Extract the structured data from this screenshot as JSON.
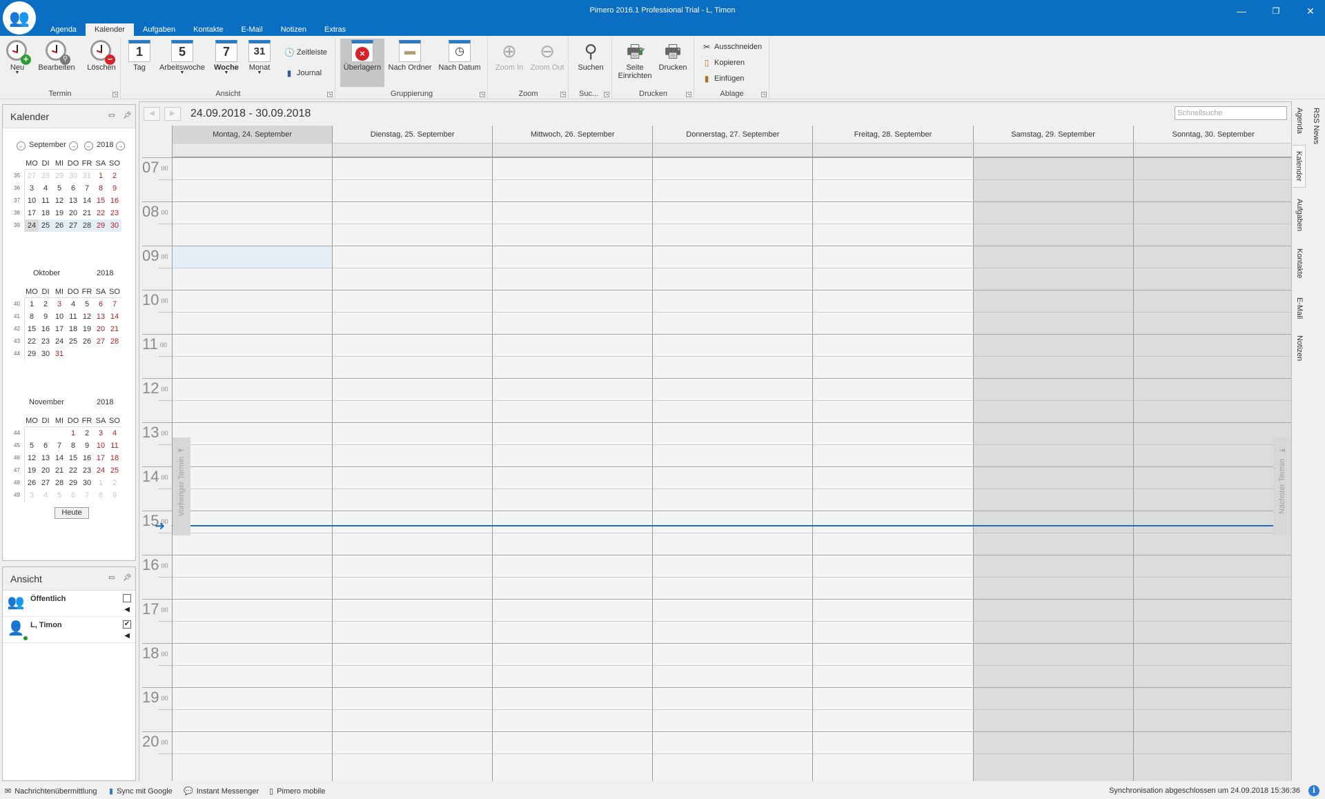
{
  "window": {
    "title": "Pimero 2016.1 Professional Trial  - L, Timon",
    "controls": [
      "minimize",
      "restore",
      "close"
    ]
  },
  "menu_tabs": [
    {
      "label": "Agenda",
      "active": false
    },
    {
      "label": "Kalender",
      "active": true
    },
    {
      "label": "Aufgaben",
      "active": false
    },
    {
      "label": "Kontakte",
      "active": false
    },
    {
      "label": "E-Mail",
      "active": false
    },
    {
      "label": "Notizen",
      "active": false
    },
    {
      "label": "Extras",
      "active": false
    }
  ],
  "ribbon": {
    "groups": {
      "termin": "Termin",
      "ansicht": "Ansicht",
      "gruppierung": "Gruppierung",
      "zoom": "Zoom",
      "suchen": "Suc...",
      "drucken": "Drucken",
      "ablage": "Ablage"
    },
    "buttons": {
      "neu": "Neu",
      "bearbeiten": "Bearbeiten",
      "loeschen": "Löschen",
      "tag": "Tag",
      "tag_num": "1",
      "arbeitswoche": "Arbeitswoche",
      "arbeitswoche_num": "5",
      "woche": "Woche",
      "woche_num": "7",
      "monat": "Monat",
      "monat_num": "31",
      "zeitleiste": "Zeitleiste",
      "journal": "Journal",
      "ueberlagern": "Überlagern",
      "nach_ordner": "Nach Ordner",
      "nach_datum": "Nach Datum",
      "zoom_in": "Zoom In",
      "zoom_out": "Zoom Out",
      "suchen": "Suchen",
      "seite_einrichten_1": "Seite",
      "seite_einrichten_2": "Einrichten",
      "drucken": "Drucken",
      "ausschneiden": "Ausschneiden",
      "kopieren": "Kopieren",
      "einfuegen": "Einfügen"
    }
  },
  "kalender_panel": {
    "title": "Kalender",
    "months": [
      {
        "month": "September",
        "year": "2018",
        "show_nav": true,
        "dow": [
          "MO",
          "DI",
          "MI",
          "DO",
          "FR",
          "SA",
          "SO"
        ],
        "weeks": [
          {
            "wk": "35",
            "days": [
              [
                "27",
                "other"
              ],
              [
                "28",
                "other"
              ],
              [
                "29",
                "other"
              ],
              [
                "30",
                "other"
              ],
              [
                "31",
                "other"
              ],
              [
                "1",
                "we"
              ],
              [
                "2",
                "we"
              ]
            ]
          },
          {
            "wk": "36",
            "days": [
              [
                "3",
                ""
              ],
              [
                "4",
                ""
              ],
              [
                "5",
                ""
              ],
              [
                "6",
                ""
              ],
              [
                "7",
                ""
              ],
              [
                "8",
                "we"
              ],
              [
                "9",
                "we"
              ]
            ]
          },
          {
            "wk": "37",
            "days": [
              [
                "10",
                ""
              ],
              [
                "11",
                ""
              ],
              [
                "12",
                ""
              ],
              [
                "13",
                ""
              ],
              [
                "14",
                ""
              ],
              [
                "15",
                "we"
              ],
              [
                "16",
                "we"
              ]
            ]
          },
          {
            "wk": "38",
            "days": [
              [
                "17",
                ""
              ],
              [
                "18",
                ""
              ],
              [
                "19",
                ""
              ],
              [
                "20",
                ""
              ],
              [
                "21",
                ""
              ],
              [
                "22",
                "we"
              ],
              [
                "23",
                "we"
              ]
            ]
          },
          {
            "wk": "39",
            "days": [
              [
                "24",
                "today"
              ],
              [
                "25",
                "sel"
              ],
              [
                "26",
                "sel"
              ],
              [
                "27",
                "sel"
              ],
              [
                "28",
                "sel"
              ],
              [
                "29",
                "we sel"
              ],
              [
                "30",
                "we sel"
              ]
            ]
          }
        ]
      },
      {
        "month": "Oktober",
        "year": "2018",
        "show_nav": false,
        "dow": [
          "MO",
          "DI",
          "MI",
          "DO",
          "FR",
          "SA",
          "SO"
        ],
        "weeks": [
          {
            "wk": "40",
            "days": [
              [
                "1",
                ""
              ],
              [
                "2",
                ""
              ],
              [
                "3",
                "we"
              ],
              [
                "4",
                ""
              ],
              [
                "5",
                ""
              ],
              [
                "6",
                "we"
              ],
              [
                "7",
                "we"
              ]
            ]
          },
          {
            "wk": "41",
            "days": [
              [
                "8",
                ""
              ],
              [
                "9",
                ""
              ],
              [
                "10",
                ""
              ],
              [
                "11",
                ""
              ],
              [
                "12",
                ""
              ],
              [
                "13",
                "we"
              ],
              [
                "14",
                "we"
              ]
            ]
          },
          {
            "wk": "42",
            "days": [
              [
                "15",
                ""
              ],
              [
                "16",
                ""
              ],
              [
                "17",
                ""
              ],
              [
                "18",
                ""
              ],
              [
                "19",
                ""
              ],
              [
                "20",
                "we"
              ],
              [
                "21",
                "we"
              ]
            ]
          },
          {
            "wk": "43",
            "days": [
              [
                "22",
                ""
              ],
              [
                "23",
                ""
              ],
              [
                "24",
                ""
              ],
              [
                "25",
                ""
              ],
              [
                "26",
                ""
              ],
              [
                "27",
                "we"
              ],
              [
                "28",
                "we"
              ]
            ]
          },
          {
            "wk": "44",
            "days": [
              [
                "29",
                ""
              ],
              [
                "30",
                ""
              ],
              [
                "31",
                "we"
              ],
              [
                "",
                ""
              ],
              [
                "",
                ""
              ],
              [
                "",
                ""
              ],
              [
                "",
                ""
              ]
            ]
          }
        ]
      },
      {
        "month": "November",
        "year": "2018",
        "show_nav": false,
        "dow": [
          "MO",
          "DI",
          "MI",
          "DO",
          "FR",
          "SA",
          "SO"
        ],
        "weeks": [
          {
            "wk": "44",
            "days": [
              [
                "",
                ""
              ],
              [
                "",
                ""
              ],
              [
                "",
                ""
              ],
              [
                "1",
                "we"
              ],
              [
                "2",
                ""
              ],
              [
                "3",
                "we"
              ],
              [
                "4",
                "we"
              ]
            ]
          },
          {
            "wk": "45",
            "days": [
              [
                "5",
                ""
              ],
              [
                "6",
                ""
              ],
              [
                "7",
                ""
              ],
              [
                "8",
                ""
              ],
              [
                "9",
                ""
              ],
              [
                "10",
                "we"
              ],
              [
                "11",
                "we"
              ]
            ]
          },
          {
            "wk": "46",
            "days": [
              [
                "12",
                ""
              ],
              [
                "13",
                ""
              ],
              [
                "14",
                ""
              ],
              [
                "15",
                ""
              ],
              [
                "16",
                ""
              ],
              [
                "17",
                "we"
              ],
              [
                "18",
                "we"
              ]
            ]
          },
          {
            "wk": "47",
            "days": [
              [
                "19",
                ""
              ],
              [
                "20",
                ""
              ],
              [
                "21",
                ""
              ],
              [
                "22",
                ""
              ],
              [
                "23",
                ""
              ],
              [
                "24",
                "we"
              ],
              [
                "25",
                "we"
              ]
            ]
          },
          {
            "wk": "48",
            "days": [
              [
                "26",
                ""
              ],
              [
                "27",
                ""
              ],
              [
                "28",
                ""
              ],
              [
                "29",
                ""
              ],
              [
                "30",
                ""
              ],
              [
                "1",
                "other"
              ],
              [
                "2",
                "other"
              ]
            ]
          },
          {
            "wk": "49",
            "days": [
              [
                "3",
                "other"
              ],
              [
                "4",
                "other"
              ],
              [
                "5",
                "other"
              ],
              [
                "6",
                "other"
              ],
              [
                "7",
                "other"
              ],
              [
                "8",
                "other"
              ],
              [
                "9",
                "other"
              ]
            ]
          }
        ]
      }
    ],
    "today_button": "Heute"
  },
  "ansicht_panel": {
    "title": "Ansicht",
    "items": [
      {
        "name": "Öffentlich",
        "checked": false,
        "icon": "group-icon"
      },
      {
        "name": "L, Timon",
        "checked": true,
        "icon": "user-icon",
        "online": true
      }
    ]
  },
  "calendar": {
    "range_title": "24.09.2018 - 30.09.2018",
    "quick_search_placeholder": "Schnellsuche",
    "days": [
      {
        "label": "Montag, 24. September",
        "current": true,
        "weekend": false
      },
      {
        "label": "Dienstag, 25. September",
        "current": false,
        "weekend": false
      },
      {
        "label": "Mittwoch, 26. September",
        "current": false,
        "weekend": false
      },
      {
        "label": "Donnerstag, 27. September",
        "current": false,
        "weekend": false
      },
      {
        "label": "Freitag, 28. September",
        "current": false,
        "weekend": false
      },
      {
        "label": "Samstag, 29. September",
        "current": false,
        "weekend": true
      },
      {
        "label": "Sonntag, 30. September",
        "current": false,
        "weekend": true
      }
    ],
    "hours": [
      "07",
      "08",
      "09",
      "10",
      "11",
      "12",
      "13",
      "14",
      "15",
      "16",
      "17",
      "18",
      "19",
      "20"
    ],
    "minutes_label": "00",
    "first_hour": 7,
    "selected_slot": {
      "day_index": 0,
      "start": "09:00",
      "end": "09:30"
    },
    "current_time": "15:20",
    "prev_appointment": "Vorheriger Termin",
    "next_appointment": "Nächster Termin"
  },
  "side_tabs": [
    {
      "label": "Agenda",
      "active": false
    },
    {
      "label": "Kalender",
      "active": true
    },
    {
      "label": "Aufgaben",
      "active": false
    },
    {
      "label": "Kontakte",
      "active": false
    },
    {
      "label": "E-Mail",
      "active": false
    },
    {
      "label": "Notizen",
      "active": false
    },
    {
      "label": "RSS News",
      "active": false
    }
  ],
  "statusbar": {
    "items": [
      {
        "label": "Nachrichtenübermittlung",
        "icon": "envelope-icon"
      },
      {
        "label": "Sync mit Google",
        "icon": "sync-icon"
      },
      {
        "label": "Instant Messenger",
        "icon": "messenger-icon"
      },
      {
        "label": "Pimero mobile",
        "icon": "phone-icon"
      }
    ],
    "sync_status": "Synchronisation abgeschlossen um 24.09.2018 15:36:36"
  },
  "colors": {
    "accent": "#0a6fc2",
    "now_line": "#1b6ec2",
    "weekend_text": "#b22222",
    "selection": "#e4eef7"
  }
}
